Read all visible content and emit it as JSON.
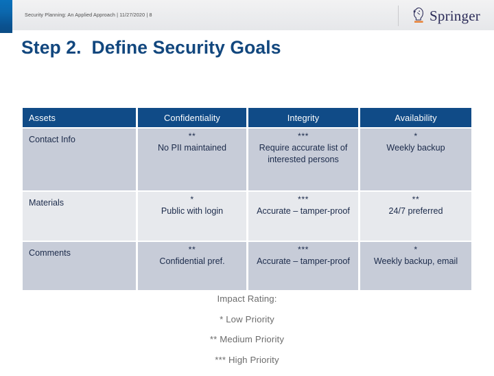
{
  "header": {
    "breadcrumb": "Security Planning: An Applied Approach | 11/27/2020 | 8",
    "logo_text": "Springer",
    "logo_icon": "springer-knight-icon"
  },
  "title": "Step 2.  Define Security Goals",
  "table": {
    "columns": [
      "Assets",
      "Confidentiality",
      "Integrity",
      "Availability"
    ],
    "rows": [
      {
        "asset": "Contact Info",
        "confidentiality": {
          "stars": "**",
          "note": "No PII maintained"
        },
        "integrity": {
          "stars": "***",
          "note": "Require accurate list of interested persons"
        },
        "availability": {
          "stars": "*",
          "note": "Weekly backup"
        }
      },
      {
        "asset": "Materials",
        "confidentiality": {
          "stars": "*",
          "note": "Public with login"
        },
        "integrity": {
          "stars": "***",
          "note": "Accurate – tamper-proof"
        },
        "availability": {
          "stars": "**",
          "note": "24/7 preferred"
        }
      },
      {
        "asset": "Comments",
        "confidentiality": {
          "stars": "**",
          "note": "Confidential  pref."
        },
        "integrity": {
          "stars": "***",
          "note": "Accurate – tamper-proof"
        },
        "availability": {
          "stars": "*",
          "note": "Weekly backup, email"
        }
      }
    ]
  },
  "legend": {
    "heading": "Impact Rating:",
    "low": "* Low Priority",
    "medium": "** Medium Priority",
    "high": "*** High Priority"
  },
  "colors": {
    "accent_blue": "#0a71bb",
    "header_blue": "#104b87",
    "title_blue": "#12477e",
    "row_shade_a": "#c7ccd8",
    "row_shade_b": "#e7e9ed",
    "legend_gray": "#6b6b6b",
    "logo_orange": "#e8833a"
  }
}
